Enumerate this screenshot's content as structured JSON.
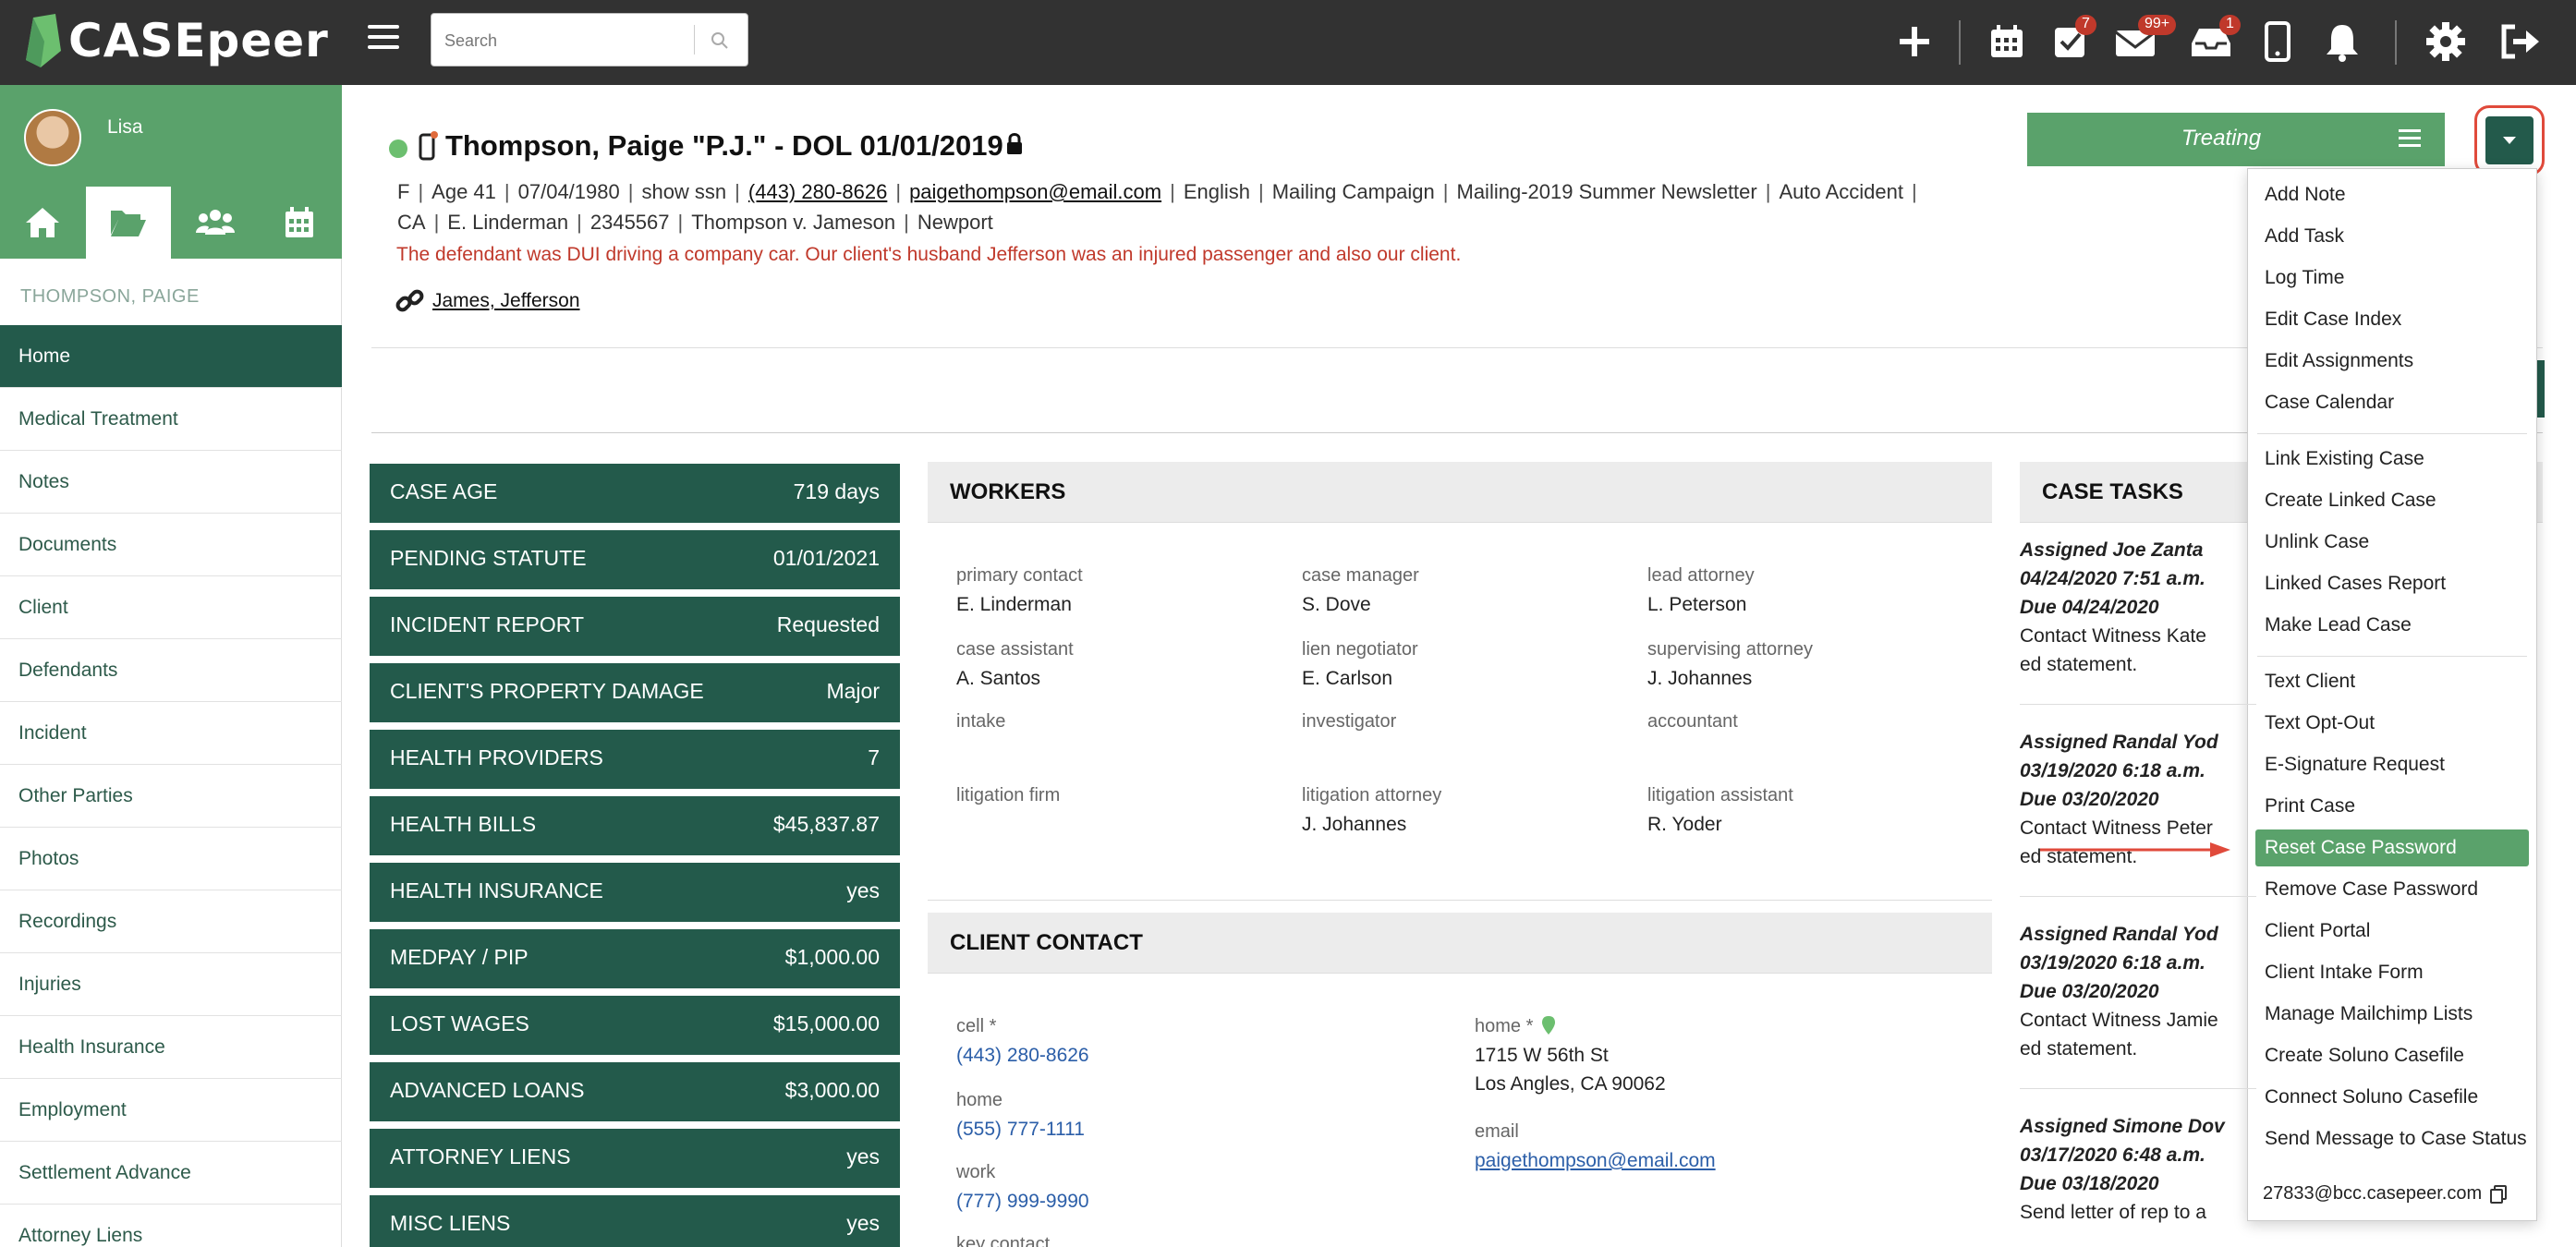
{
  "app": {
    "logo_text": "CASEpeer",
    "search_placeholder": "Search",
    "badges": {
      "tasks": "7",
      "messages": "99+",
      "inbox": "1"
    }
  },
  "sidebar": {
    "username": "Lisa",
    "client_name": "THOMPSON, PAIGE",
    "items": [
      {
        "label": "Home",
        "active": true
      },
      {
        "label": "Medical Treatment"
      },
      {
        "label": "Notes"
      },
      {
        "label": "Documents"
      },
      {
        "label": "Client"
      },
      {
        "label": "Defendants"
      },
      {
        "label": "Incident"
      },
      {
        "label": "Other Parties"
      },
      {
        "label": "Photos"
      },
      {
        "label": "Recordings"
      },
      {
        "label": "Injuries"
      },
      {
        "label": "Health Insurance"
      },
      {
        "label": "Employment"
      },
      {
        "label": "Settlement Advance"
      },
      {
        "label": "Attorney Liens"
      }
    ]
  },
  "case": {
    "title": "Thompson, Paige \"P.J.\" - DOL 01/01/2019",
    "line1": [
      "F",
      "Age 41",
      "07/04/1980",
      "show ssn",
      "(443) 280-8626",
      "paigethompson@email.com",
      "English",
      "Mailing Campaign",
      "Mailing-2019 Summer Newsletter",
      "Auto Accident"
    ],
    "line2": [
      "CA",
      "E. Linderman",
      "2345567",
      "Thompson v. Jameson",
      "Newport"
    ],
    "note": "The defendant was DUI driving a company car. Our client's husband Jefferson was an injured passenger and also our client.",
    "linked_case": "James, Jefferson",
    "status": "Treating"
  },
  "stats": [
    {
      "label": "CASE AGE",
      "value": "719 days"
    },
    {
      "label": "PENDING STATUTE",
      "value": "01/01/2021"
    },
    {
      "label": "INCIDENT REPORT",
      "value": "Requested"
    },
    {
      "label": "CLIENT'S PROPERTY DAMAGE",
      "value": "Major"
    },
    {
      "label": "HEALTH PROVIDERS",
      "value": "7"
    },
    {
      "label": "HEALTH BILLS",
      "value": "$45,837.87"
    },
    {
      "label": "HEALTH INSURANCE",
      "value": "yes"
    },
    {
      "label": "MEDPAY / PIP",
      "value": "$1,000.00"
    },
    {
      "label": "LOST WAGES",
      "value": "$15,000.00"
    },
    {
      "label": "ADVANCED LOANS",
      "value": "$3,000.00"
    },
    {
      "label": "ATTORNEY LIENS",
      "value": "yes"
    },
    {
      "label": "MISC LIENS",
      "value": "yes"
    }
  ],
  "workers": {
    "title": "WORKERS",
    "fields": [
      {
        "label": "primary contact",
        "value": "E. Linderman"
      },
      {
        "label": "case manager",
        "value": "S. Dove"
      },
      {
        "label": "lead attorney",
        "value": "L. Peterson"
      },
      {
        "label": "case assistant",
        "value": "A. Santos"
      },
      {
        "label": "lien negotiator",
        "value": "E. Carlson"
      },
      {
        "label": "supervising attorney",
        "value": "J. Johannes"
      },
      {
        "label": "intake",
        "value": ""
      },
      {
        "label": "investigator",
        "value": ""
      },
      {
        "label": "accountant",
        "value": ""
      },
      {
        "label": "litigation firm",
        "value": ""
      },
      {
        "label": "litigation attorney",
        "value": "J. Johannes"
      },
      {
        "label": "litigation assistant",
        "value": "R. Yoder"
      }
    ]
  },
  "client_contact": {
    "title": "CLIENT CONTACT",
    "cell_label": "cell *",
    "cell": "(443) 280-8626",
    "home_label": "home",
    "home": "(555) 777-1111",
    "work_label": "work",
    "work": "(777) 999-9990",
    "key_contact_label": "key contact",
    "home_addr_label": "home *",
    "addr1": "1715 W 56th St",
    "addr2": "Los Angles, CA 90062",
    "email_label": "email",
    "email": "paigethompson@email.com"
  },
  "case_tasks": {
    "title": "CASE TASKS",
    "items": [
      {
        "assigned": "Assigned Joe Zanta",
        "date": "04/24/2020 7:51 a.m.",
        "due": "Due 04/24/2020",
        "desc1": "Contact Witness Kate",
        "desc2": "ed statement."
      },
      {
        "assigned": "Assigned Randal Yod",
        "date": "03/19/2020 6:18 a.m.",
        "due": "Due 03/20/2020",
        "desc1": "Contact Witness Peter",
        "desc2": "ed statement."
      },
      {
        "assigned": "Assigned Randal Yod",
        "date": "03/19/2020 6:18 a.m.",
        "due": "Due 03/20/2020",
        "desc1": "Contact Witness Jamie",
        "desc2": "ed statement."
      },
      {
        "assigned": "Assigned Simone Dov",
        "date": "03/17/2020 6:48 a.m.",
        "due": "Due 03/18/2020",
        "desc1": "Send letter of rep to a",
        "desc2": ""
      }
    ]
  },
  "dropdown": {
    "groups": [
      [
        "Add Note",
        "Add Task",
        "Log Time",
        "Edit Case Index",
        "Edit Assignments",
        "Case Calendar"
      ],
      [
        "Link Existing Case",
        "Create Linked Case",
        "Unlink Case",
        "Linked Cases Report",
        "Make Lead Case"
      ],
      [
        "Text Client",
        "Text Opt-Out",
        "E-Signature Request",
        "Print Case",
        "Reset Case Password",
        "Remove Case Password",
        "Client Portal",
        "Client Intake Form",
        "Manage Mailchimp Lists",
        "Create Soluno Casefile",
        "Connect Soluno Casefile",
        "Send Message to Case Status"
      ]
    ],
    "highlighted": "Reset Case Password",
    "email": "27833@bcc.casepeer.com"
  },
  "colors": {
    "topbar": "#323232",
    "brand_green": "#5aa26b",
    "dark_green": "#235a4b",
    "alert_red": "#c0392b",
    "link_blue": "#2b5ea8"
  }
}
